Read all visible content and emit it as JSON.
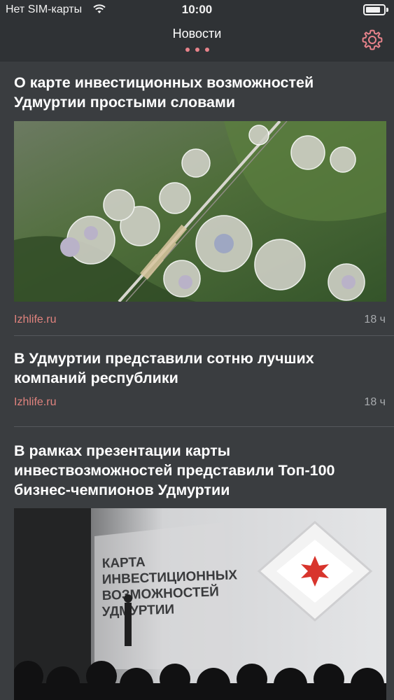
{
  "status_bar": {
    "carrier": "Нет SIM-карты",
    "time": "10:00",
    "battery_level": 0.85
  },
  "nav": {
    "title": "Новости",
    "page_dots": 3,
    "accent_color": "#e8838b",
    "settings_icon": "gear-icon"
  },
  "articles": [
    {
      "title": "О карте инвестиционных возможностей Удмуртии простыми словами",
      "image": "aerial-city-plan",
      "source": "Izhlife.ru",
      "time": "18 ч"
    },
    {
      "title": "В Удмуртии представили сотню лучших компаний республики",
      "source": "Izhlife.ru",
      "time": "18 ч"
    },
    {
      "title": "В рамках презентации карты инвествозможностей представили Топ-100 бизнес-чемпионов Удмуртии",
      "image": "presentation-stage",
      "image_text": "КАРТА ИНВЕСТИЦИОННЫХ ВОЗМОЖНОСТЕЙ УДМУРТИИ"
    }
  ]
}
